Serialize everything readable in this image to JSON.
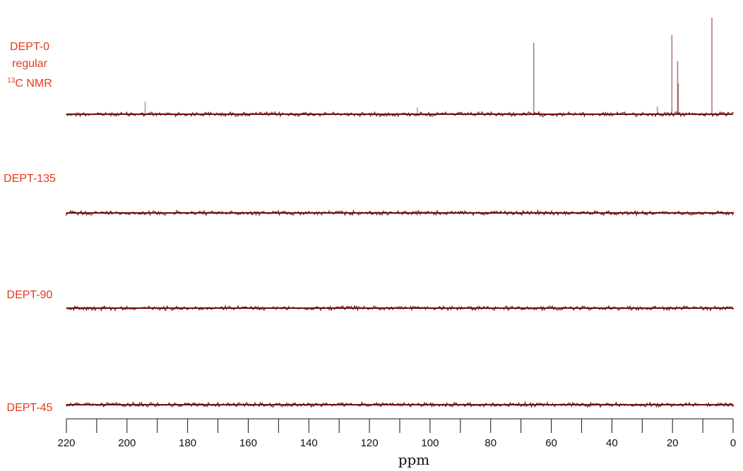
{
  "chart_data": {
    "type": "line",
    "xlabel": "ppm",
    "xlim": [
      220,
      0
    ],
    "x_reversed": true,
    "x_ticks": [
      220,
      200,
      180,
      160,
      140,
      120,
      100,
      80,
      60,
      40,
      20,
      0
    ],
    "x_minor_tick_step": 10,
    "grid": false,
    "line_color": "#6b1010",
    "label_color": "#e8371b",
    "series": [
      {
        "name": "DEPT-0 regular 13C NMR",
        "label_lines": [
          "DEPT-0",
          "regular",
          "13C NMR"
        ],
        "peaks": [
          {
            "ppm": 194.0,
            "height": 0.13
          },
          {
            "ppm": 104.2,
            "height": 0.07
          },
          {
            "ppm": 65.8,
            "height": 0.74
          },
          {
            "ppm": 25.0,
            "height": 0.08
          },
          {
            "ppm": 20.2,
            "height": 0.82
          },
          {
            "ppm": 18.3,
            "height": 0.55
          },
          {
            "ppm": 18.1,
            "height": 0.32
          },
          {
            "ppm": 7.0,
            "height": 1.0
          }
        ]
      },
      {
        "name": "DEPT-135",
        "label_lines": [
          "DEPT-135"
        ],
        "peaks": []
      },
      {
        "name": "DEPT-90",
        "label_lines": [
          "DEPT-90"
        ],
        "peaks": []
      },
      {
        "name": "DEPT-45",
        "label_lines": [
          "DEPT-45"
        ],
        "peaks": []
      }
    ]
  }
}
